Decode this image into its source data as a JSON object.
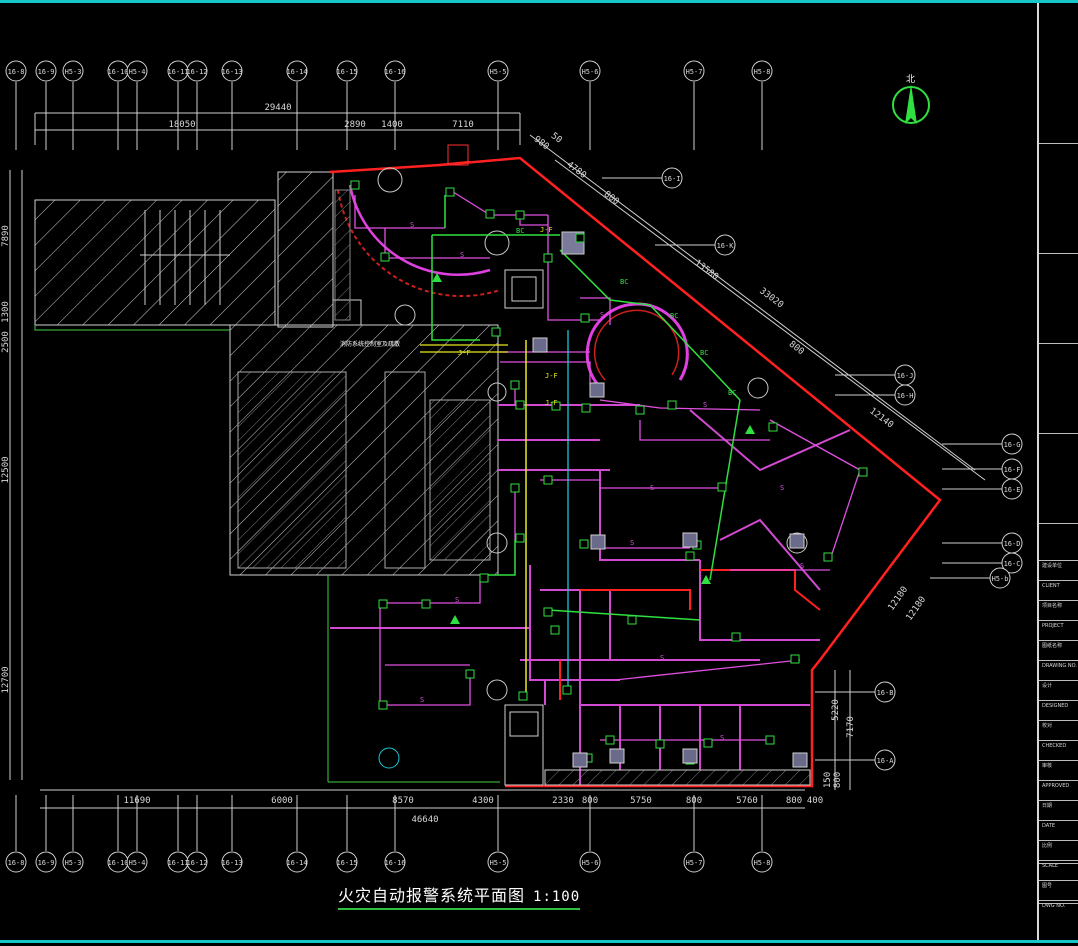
{
  "drawing": {
    "title": "火灾自动报警系统平面图",
    "scale": "1:100",
    "north_label": "北",
    "center_note": "消防系统控制室及疏散",
    "axes_top": [
      "16-8",
      "16-9",
      "H5-3",
      "16-10",
      "H5-4",
      "16-11",
      "16-12",
      "16-13",
      "16-14",
      "16-15",
      "16-16",
      "H5-5",
      "H5-6",
      "H5-7",
      "H5-8"
    ],
    "axes_bottom": [
      "16-8",
      "16-9",
      "H5-3",
      "16-10",
      "H5-4",
      "16-11",
      "16-12",
      "16-13",
      "16-14",
      "16-15",
      "16-16",
      "H5-5",
      "H5-6",
      "H5-7",
      "H5-8"
    ],
    "axes_right": [
      "16-I",
      "16-K",
      "16-J",
      "16-H",
      "16-G",
      "16-F",
      "16-E",
      "16-D",
      "16-C",
      "H5-b",
      "16-B",
      "16-A"
    ],
    "dims_top_total": "29440",
    "dims_top": [
      "18050",
      "2890",
      "1400",
      "7110"
    ],
    "dims_left": [
      "7890",
      "1300",
      "2500",
      "12500",
      "12700"
    ],
    "dims_bottom_total": "46640",
    "dims_bottom": [
      "11690",
      "6000",
      "8570",
      "4300",
      "2330",
      "800",
      "5750",
      "800",
      "5760",
      "800",
      "400"
    ],
    "dims_diag": [
      "980",
      "50",
      "4780",
      "800",
      "13580",
      "33020",
      "800",
      "12140",
      "12180",
      "12180"
    ],
    "dims_right": [
      "5220",
      "7170",
      "150",
      "800"
    ],
    "labels": {
      "detector": "S",
      "bc": "BC",
      "jf": "J-F"
    }
  },
  "title_block": {
    "rows": [
      "建设单位",
      "CLIENT",
      "项目名称",
      "PROJECT",
      "图纸名称",
      "DRAWING NO.",
      "设计",
      "DESIGNED",
      "校对",
      "CHECKED",
      "审核",
      "APPROVED",
      "日期",
      "DATE",
      "比例",
      "SCALE",
      "图号",
      "DWG NO."
    ]
  }
}
